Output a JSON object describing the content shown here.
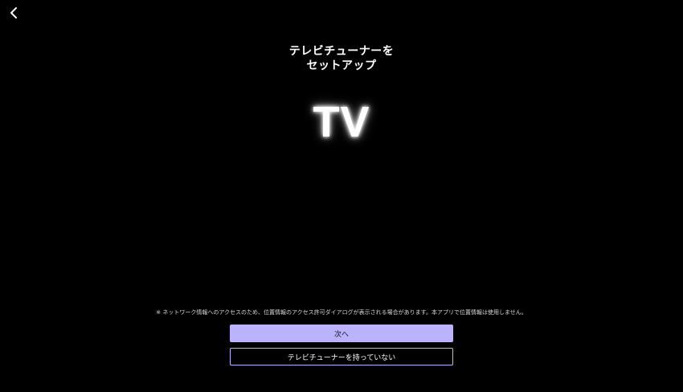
{
  "header": {
    "back_icon": "chevron-left-icon"
  },
  "title": {
    "line1": "テレビチューナーを",
    "line2": "セットアップ"
  },
  "logo": {
    "text": "TV"
  },
  "notice": {
    "text": "※ ネットワーク情報へのアクセスのため、位置情報のアクセス許可ダイアログが表示される場合があります。本アプリで位置情報は使用しません。"
  },
  "buttons": {
    "next_label": "次へ",
    "no_tuner_label": "テレビチューナーを持っていない"
  },
  "colors": {
    "background": "#000000",
    "accent": "#bcb3ff"
  }
}
